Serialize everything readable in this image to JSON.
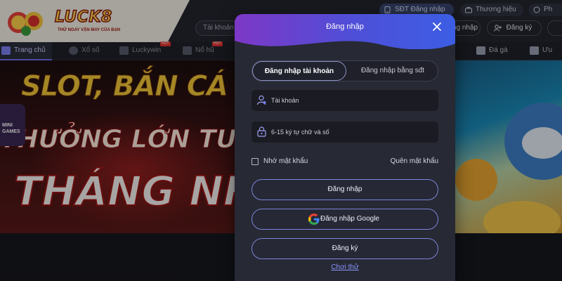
{
  "header": {
    "logo_text": "LUCK8",
    "logo_tagline": "THỬ NGAY VẬN MAY CỦA BẠN",
    "pills": {
      "phone": "SĐT Đăng nhập",
      "brand": "Thương hiệu",
      "other": "Ph"
    },
    "search_placeholder": "Tài khoản",
    "right_buttons": {
      "login": "ng nhập",
      "register": "Đăng ký",
      "more": ""
    }
  },
  "nav": {
    "items": [
      {
        "label": "Trang chủ"
      },
      {
        "label": "Xổ số"
      },
      {
        "label": "Luckywin"
      },
      {
        "label": "Nổ hũ"
      },
      {
        "label": "Đá gà"
      },
      {
        "label": "Ưu đãi"
      }
    ],
    "hot_badge": "HOT"
  },
  "banner": {
    "line1": "SLOT, BẮN CÁ TH",
    "line2": "THƯỞNG LỚN TUẦN",
    "line3": "THÁNG NHẬN",
    "mini_games": "MINI GAMES"
  },
  "modal": {
    "title": "Đăng nhập",
    "tabs": {
      "account": "Đăng nhập tài khoản",
      "phone": "Đăng nhập bằng sđt"
    },
    "username_placeholder": "Tài khoản",
    "password_placeholder": "6-15 ký tự chữ và số",
    "remember_label": "Nhớ mật khẩu",
    "forgot_label": "Quên mật khẩu",
    "login_button": "Đăng nhập",
    "google_button": "Đăng nhập Google",
    "register_button": "Đăng ký",
    "try_link": "Chơi thử"
  },
  "colors": {
    "modal_header_start": "#7d38c6",
    "modal_header_end": "#3c5ee4",
    "button_border": "#7d85d8",
    "link": "#8a95ff"
  },
  "icons": [
    "user-icon",
    "lock-icon",
    "close-icon",
    "google-icon",
    "phone-icon",
    "brand-icon",
    "add-user-icon"
  ]
}
